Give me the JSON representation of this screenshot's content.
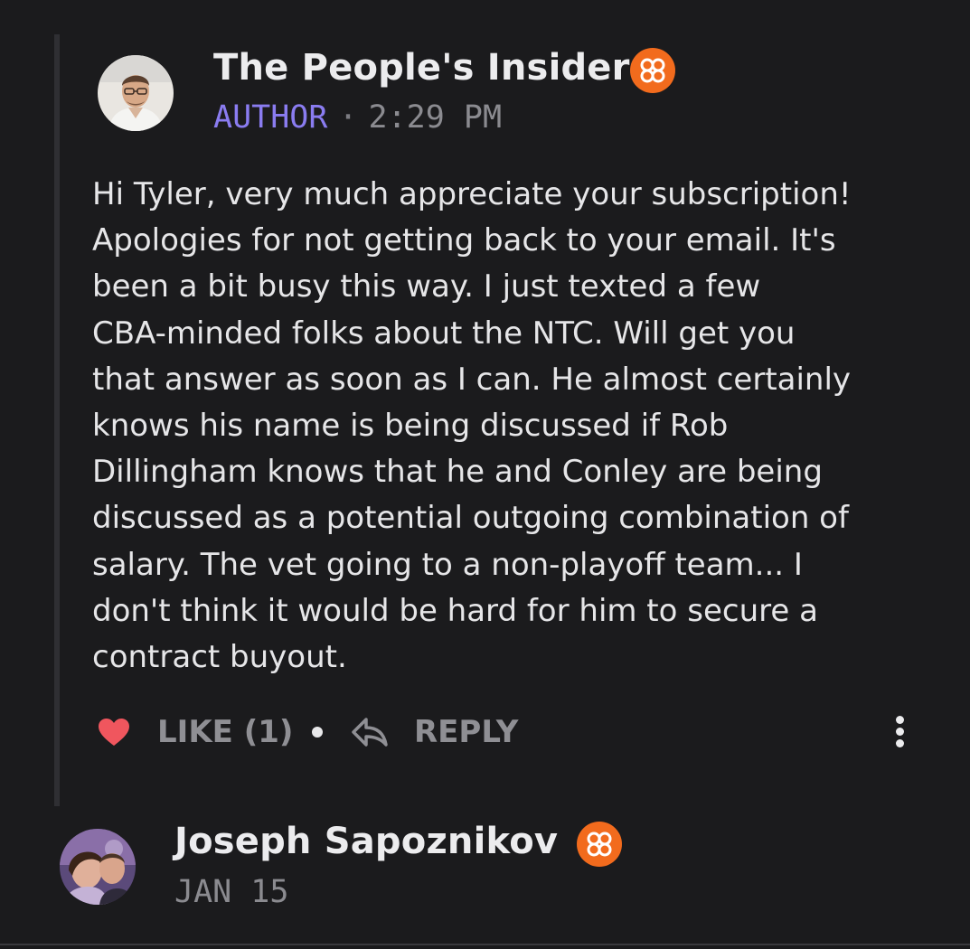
{
  "comments": [
    {
      "author": "The People's Insider",
      "role": "AUTHOR",
      "separator": "·",
      "time": "2:29 PM",
      "avatar_icon": "profile-photo-man-glasses",
      "badge_icon": "subscriber-badge-icon",
      "body": "Hi Tyler, very much appreciate your subscription!\nApologies for not getting back to your email. It's\nbeen a bit busy this way. I just texted a few\nCBA-minded folks about the NTC. Will get you\nthat answer as soon as I can. He almost certainly\nknows his name is being discussed if Rob\nDillingham knows that he and Conley are being\ndiscussed as a potential outgoing combination of\nsalary. The vet going to a non-playoff team... I\ndon't think it would be hard for him to secure a\ncontract buyout.",
      "like_label": "LIKE (1)",
      "reply_label": "REPLY",
      "liked": true
    },
    {
      "author": "Joseph Sapoznikov",
      "time": "JAN 15",
      "avatar_icon": "profile-photo-couple",
      "badge_icon": "subscriber-badge-icon"
    }
  ],
  "colors": {
    "background": "#1b1b1d",
    "author_tag": "#8a7cf0",
    "badge": "#f26b1d",
    "like_heart": "#f0565e",
    "muted": "#8f8f94"
  }
}
